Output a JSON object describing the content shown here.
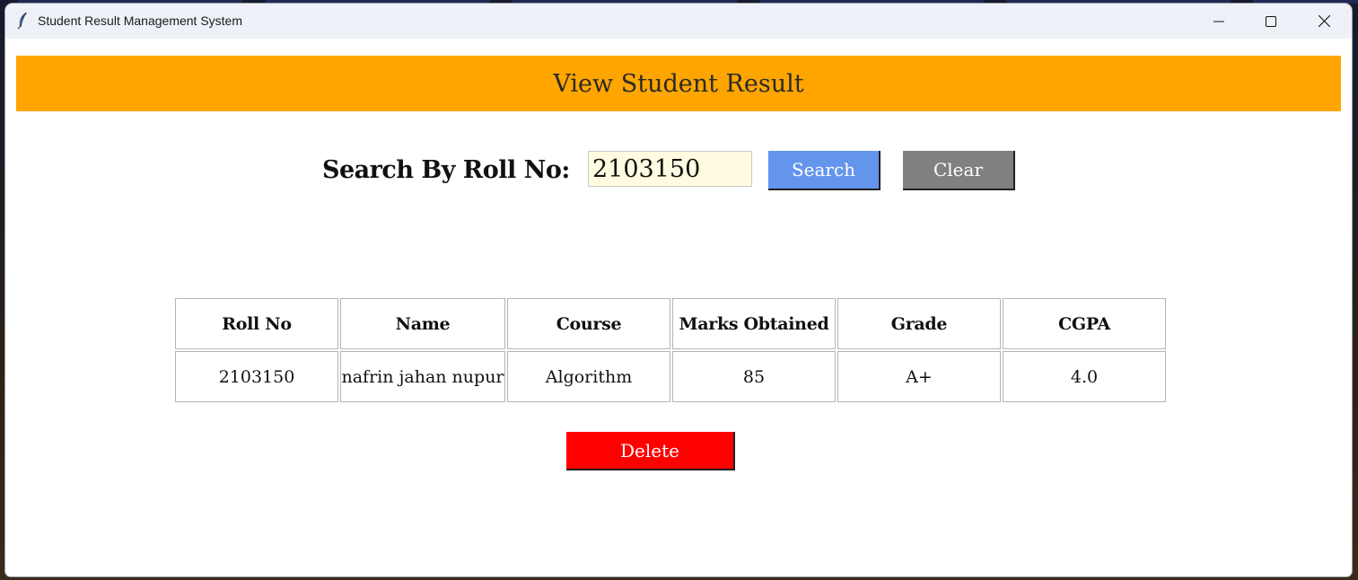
{
  "window": {
    "title": "Student Result Management System",
    "icon": "feather-icon"
  },
  "banner": {
    "title": "View Student Result",
    "background": "#ffa500"
  },
  "search": {
    "label": "Search By Roll No:",
    "value": "2103150",
    "input_background": "#fffbe0",
    "search_button": "Search",
    "clear_button": "Clear",
    "search_button_color": "#6495ed",
    "clear_button_color": "#808080"
  },
  "results": {
    "columns": [
      "Roll No",
      "Name",
      "Course",
      "Marks Obtained",
      "Grade",
      "CGPA"
    ],
    "rows": [
      [
        "2103150",
        "nafrin jahan nupur",
        "Algorithm",
        "85",
        "A+",
        "4.0"
      ]
    ]
  },
  "actions": {
    "delete_button": "Delete",
    "delete_button_color": "#ff0000"
  }
}
